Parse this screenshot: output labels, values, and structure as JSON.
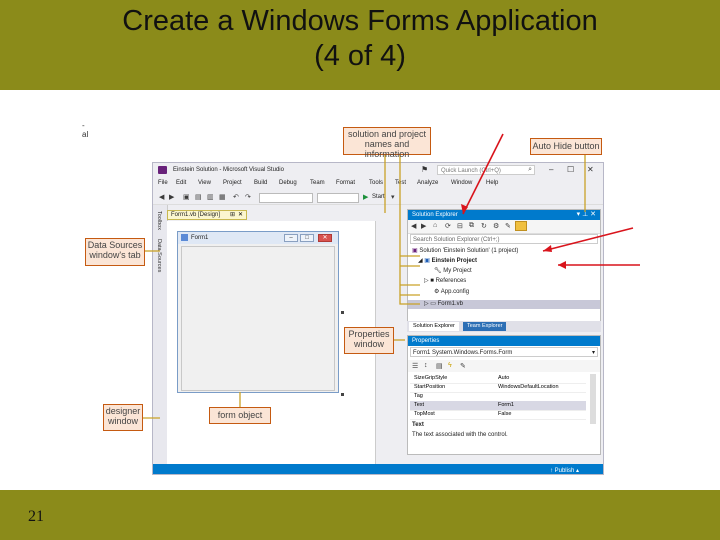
{
  "slide": {
    "title_line1": "Create a Windows Forms Application",
    "title_line2": "(4 of 4)",
    "number": "21",
    "stray_mark": "-\nal"
  },
  "colors": {
    "bar": "#8b8b1a",
    "callout_border": "#c55a11",
    "callout_fill": "#fbe5d6",
    "vs_accent": "#007acc",
    "arrow": "#d9141c",
    "leader": "#c9a227"
  },
  "vs": {
    "window_title": "Einstein Solution - Microsoft Visual Studio",
    "quick_launch": "Quick Launch (Ctrl+Q)",
    "menu": [
      "File",
      "Edit",
      "View",
      "Project",
      "Build",
      "Debug",
      "Team",
      "Format",
      "Tools",
      "Test",
      "Analyze",
      "Window",
      "Help"
    ],
    "start_label": "Start",
    "side_tabs": [
      "Toolbox",
      "Data Sources"
    ],
    "doc_tab": "Form1.vb [Design]",
    "form_title": "Form1",
    "solution_explorer": {
      "title": "Solution Explorer",
      "search_placeholder": "Search Solution Explorer (Ctrl+;)",
      "tree": [
        "Solution 'Einstein Solution' (1 project)",
        "Einstein Project",
        "My Project",
        "References",
        "App.config",
        "Form1.vb"
      ]
    },
    "bottom_tabs": [
      "Solution Explorer",
      "Team Explorer"
    ],
    "properties": {
      "title": "Properties",
      "object": "Form1 System.Windows.Forms.Form",
      "rows": [
        {
          "name": "SizeGripStyle",
          "value": "Auto"
        },
        {
          "name": "StartPosition",
          "value": "WindowsDefaultLocation"
        },
        {
          "name": "Tag",
          "value": ""
        },
        {
          "name": "Text",
          "value": "Form1"
        },
        {
          "name": "TopMost",
          "value": "False"
        }
      ],
      "desc_title": "Text",
      "desc": "The text associated with the control."
    },
    "status": "↑ Publish ▴"
  },
  "callouts": {
    "solution": "solution and project names and information",
    "autohide": "Auto Hide button",
    "datasources": "Data Sources window's tab",
    "properties": "Properties window",
    "designer": "designer window",
    "formobject": "form object"
  }
}
